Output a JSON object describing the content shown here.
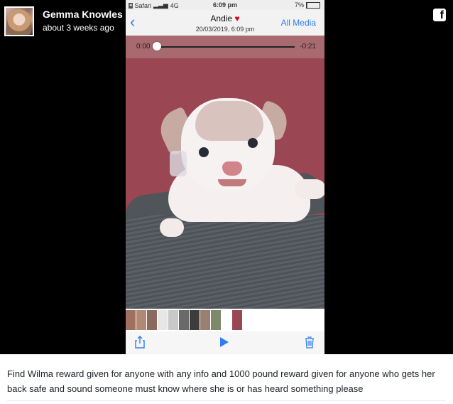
{
  "post": {
    "author": "Gemma Knowles",
    "time": "about 3 weeks ago",
    "caption": "Find Wilma reward given for anyone with any info and 1000 pound reward given for anyone who gets her back safe and sound someone must know where she is or has heard something please"
  },
  "brand": {
    "logo_letter": "f"
  },
  "phone": {
    "status": {
      "back_app": "Safari",
      "network": "4G",
      "time": "6:09 pm",
      "battery": "7%",
      "battery_level": 0.07
    },
    "nav": {
      "back_symbol": "‹",
      "title": "Andie",
      "title_icon": "heart-icon",
      "date": "20/03/2019, 6:09 pm",
      "all_media": "All Media"
    },
    "player": {
      "elapsed": "0:00",
      "remaining": "-0:21",
      "progress": 0.0
    },
    "toolbar": {
      "share": "share-icon",
      "play": "play-icon",
      "delete": "trash-icon"
    }
  },
  "colors": {
    "accent": "#2f7cf6",
    "heart": "#d0021b",
    "scrubber_bg": "#a96a6f",
    "photo_bg": "#9b4653"
  }
}
